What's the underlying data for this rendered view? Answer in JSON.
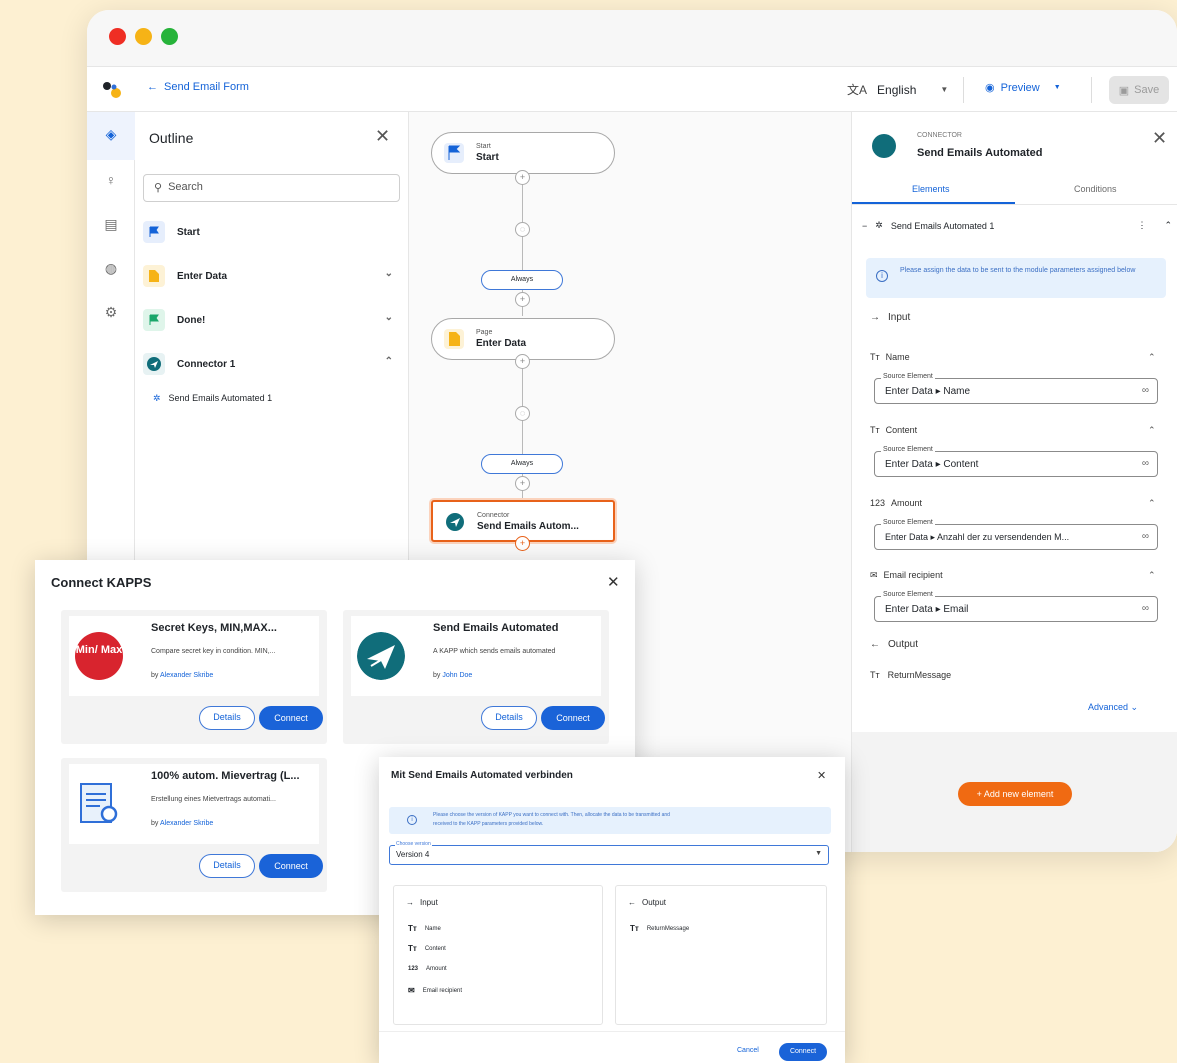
{
  "toolbar": {
    "back_label": "Send Email Form",
    "language": "English",
    "preview_label": "Preview",
    "save_label": "Save"
  },
  "outline": {
    "title": "Outline",
    "search_placeholder": "Search",
    "items": [
      {
        "label": "Start",
        "icon": "flag-icon",
        "color": "#1463d8"
      },
      {
        "label": "Enter Data",
        "icon": "page-icon",
        "color": "#f6b316"
      },
      {
        "label": "Done!",
        "icon": "flag-icon",
        "color": "#1aa66a"
      },
      {
        "label": "Connector 1",
        "icon": "connector-icon",
        "color": "#106d7a"
      }
    ],
    "subitem": "Send Emails Automated 1"
  },
  "flow": {
    "nodes": [
      {
        "small": "Start",
        "big": "Start"
      },
      {
        "small": "Page",
        "big": "Enter Data"
      },
      {
        "small": "Connector",
        "big": "Send Emails Autom..."
      }
    ],
    "transition": "Always"
  },
  "props": {
    "small": "CONNECTOR",
    "title": "Send Emails Automated",
    "tabs": [
      "Elements",
      "Conditions"
    ],
    "module": "Send Emails Automated 1",
    "info": "Please assign the data to be sent to the module parameters assigned below",
    "input_label": "Input",
    "source_legend": "Source Element",
    "fields": [
      {
        "label": "Name",
        "icon": "Tт",
        "value": "Enter Data ▸ Name"
      },
      {
        "label": "Content",
        "icon": "Tт",
        "value": "Enter Data ▸ Content"
      },
      {
        "label": "Amount",
        "icon": "123",
        "value": "Enter Data ▸ Anzahl der zu versendenden M..."
      },
      {
        "label": "Email recipient",
        "icon": "✉",
        "value": "Enter Data ▸ Email"
      }
    ],
    "output_label": "Output",
    "output_field": "ReturnMessage",
    "advanced": "Advanced",
    "add_button": "+ Add new element"
  },
  "connect_dialog": {
    "title": "Connect KAPPS",
    "details_label": "Details",
    "connect_label": "Connect",
    "cards": [
      {
        "title": "Secret Keys, MIN,MAX...",
        "desc": "Compare secret key in condition. MIN,...",
        "by": "by",
        "author": "Alexander Skribe",
        "icon_text": "Min/ Max"
      },
      {
        "title": "Send Emails Automated",
        "desc": "A KAPP which sends emails automated",
        "by": "by",
        "author": "John Doe"
      },
      {
        "title": "100% autom. Mievertrag (L...",
        "desc": "Erstellung eines Mietvertrags automati...",
        "by": "by",
        "author": "Alexander Skribe"
      }
    ]
  },
  "version_dialog": {
    "title": "Mit Send Emails Automated verbinden",
    "info_line1": "Please choose the version of KAPP you want to connect with. Then, allocate the data to be transmitted and",
    "info_line2": "received to the KAPP parameters provided below.",
    "select_legend": "Choose version",
    "select_value": "Version 4",
    "input_label": "Input",
    "output_label": "Output",
    "inputs": [
      {
        "icon": "Tт",
        "label": "Name"
      },
      {
        "icon": "Tт",
        "label": "Content"
      },
      {
        "icon": "123",
        "label": "Amount"
      },
      {
        "icon": "✉",
        "label": "Email recipient"
      }
    ],
    "outputs": [
      {
        "icon": "Tт",
        "label": "ReturnMessage"
      }
    ],
    "cancel_label": "Cancel",
    "connect_label": "Connect"
  }
}
